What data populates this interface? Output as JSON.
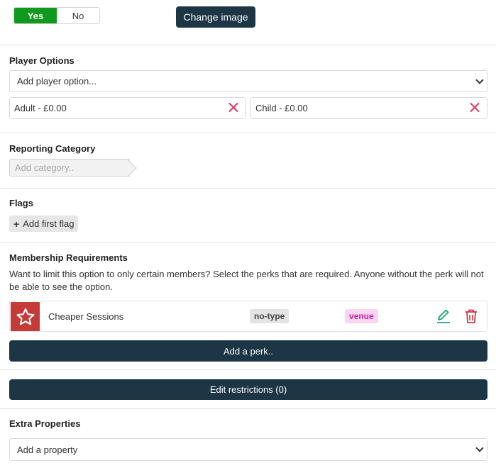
{
  "top": {
    "toggle_yes": "Yes",
    "toggle_no": "No",
    "change_image": "Change image"
  },
  "player_options": {
    "title": "Player Options",
    "select_placeholder": "Add player option...",
    "options": [
      {
        "label": "Adult - £0.00"
      },
      {
        "label": "Child - £0.00"
      }
    ]
  },
  "reporting": {
    "title": "Reporting Category",
    "placeholder": "Add category.."
  },
  "flags": {
    "title": "Flags",
    "add_label": "Add first flag",
    "add_icon": "+"
  },
  "membership": {
    "title": "Membership Requirements",
    "description": "Want to limit this option to only certain members? Select the perks that are required. Anyone without the perk will not be able to see the option.",
    "perk": {
      "icon": "star-icon",
      "name": "Cheaper Sessions",
      "type_tag": "no-type",
      "scope_tag": "venue"
    },
    "add_perk": "Add a perk.."
  },
  "restrictions": {
    "button": "Edit restrictions (0)"
  },
  "extra": {
    "title": "Extra Properties",
    "select_placeholder": "Add a property"
  },
  "colors": {
    "primary_dark": "#1c3646",
    "toggle_on": "#0f9a1d",
    "remove": "#e0365c",
    "perk_icon_bg": "#c43b37",
    "edit": "#17a870",
    "delete": "#d0323f"
  }
}
